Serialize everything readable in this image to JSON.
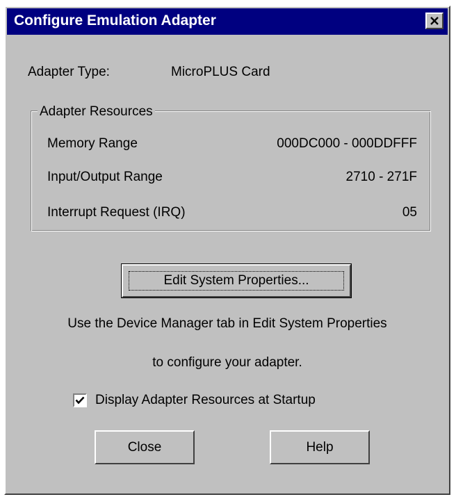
{
  "window": {
    "title": "Configure Emulation Adapter",
    "close_glyph": "✕"
  },
  "adapter": {
    "type_label": "Adapter Type:",
    "type_value": "MicroPLUS Card"
  },
  "resources": {
    "legend": "Adapter Resources",
    "rows": [
      {
        "label": "Memory Range",
        "value": "000DC000 - 000DDFFF"
      },
      {
        "label": "Input/Output Range",
        "value": "2710 - 271F"
      },
      {
        "label": "Interrupt Request (IRQ)",
        "value": "05"
      }
    ]
  },
  "edit_button": {
    "label": "Edit System Properties..."
  },
  "instructions": {
    "line1": "Use the Device Manager tab in Edit System Properties",
    "line2": "to configure your adapter."
  },
  "startup_checkbox": {
    "label": "Display Adapter Resources at Startup",
    "checked": true
  },
  "buttons": {
    "close": "Close",
    "help": "Help"
  },
  "colors": {
    "titlebar": "#000080",
    "face": "#c0c0c0"
  }
}
